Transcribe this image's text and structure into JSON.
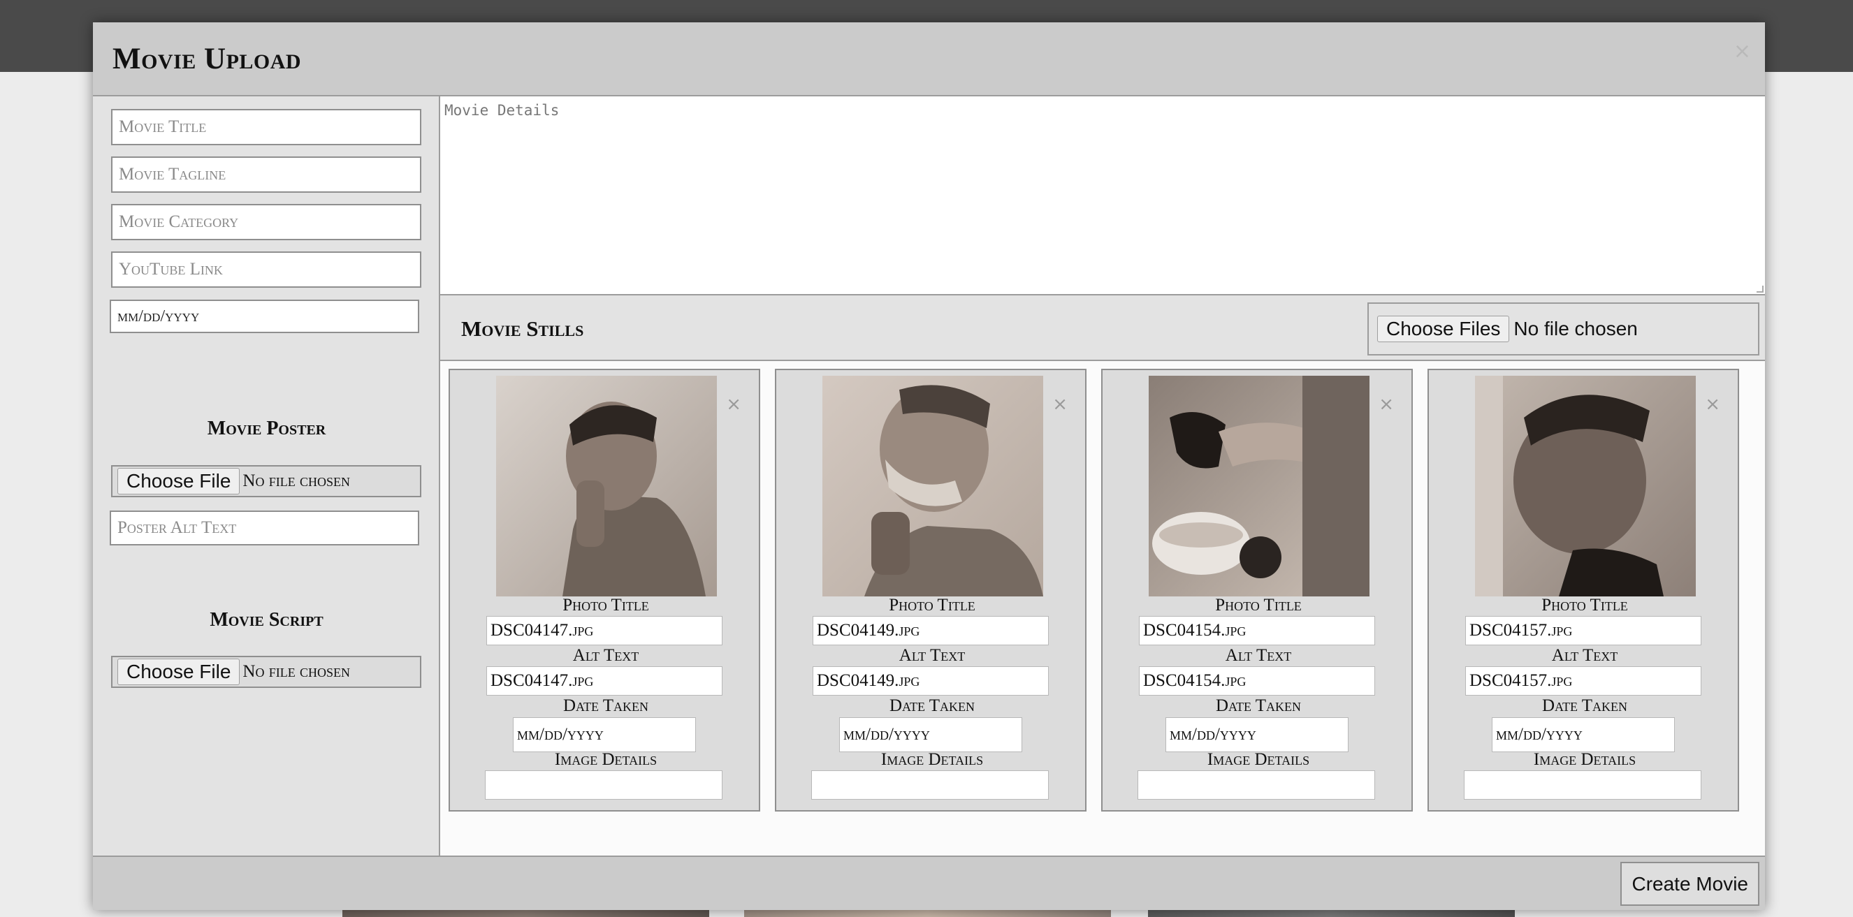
{
  "modal": {
    "title": "Movie Upload",
    "close": "×"
  },
  "form": {
    "title_placeholder": "Movie Title",
    "tagline_placeholder": "Movie Tagline",
    "category_placeholder": "Movie Category",
    "youtube_placeholder": "YouTube Link",
    "date_value": "mm/dd/yyyy",
    "poster_label": "Movie Poster",
    "choose_file": "Choose File",
    "no_file": "No file chosen",
    "poster_alt_placeholder": "Poster Alt Text",
    "script_label": "Movie Script",
    "details_placeholder": "Movie Details"
  },
  "stills": {
    "title": "Movie Stills",
    "choose_files": "Choose Files",
    "no_file": "No file chosen",
    "field_labels": {
      "photo_title": "Photo Title",
      "alt_text": "Alt Text",
      "date_taken": "Date Taken",
      "image_details": "Image Details"
    },
    "items": [
      {
        "photo_title": "DSC04147.jpg",
        "alt_text": "DSC04147.jpg",
        "date": "mm/dd/yyyy",
        "details": "",
        "remove": "×",
        "icon": "photo-icon"
      },
      {
        "photo_title": "DSC04149.jpg",
        "alt_text": "DSC04149.jpg",
        "date": "mm/dd/yyyy",
        "details": "",
        "remove": "×",
        "icon": "photo-icon"
      },
      {
        "photo_title": "DSC04154.jpg",
        "alt_text": "DSC04154.jpg",
        "date": "mm/dd/yyyy",
        "details": "",
        "remove": "×",
        "icon": "photo-icon"
      },
      {
        "photo_title": "DSC04157.jpg",
        "alt_text": "DSC04157.jpg",
        "date": "mm/dd/yyyy",
        "details": "",
        "remove": "×",
        "icon": "photo-icon"
      }
    ]
  },
  "footer": {
    "create_label": "Create Movie"
  },
  "colors": {
    "header_bg": "#cbcbcb",
    "panel_bg": "#e3e3e3",
    "page_topbar": "#4a4a4a"
  }
}
